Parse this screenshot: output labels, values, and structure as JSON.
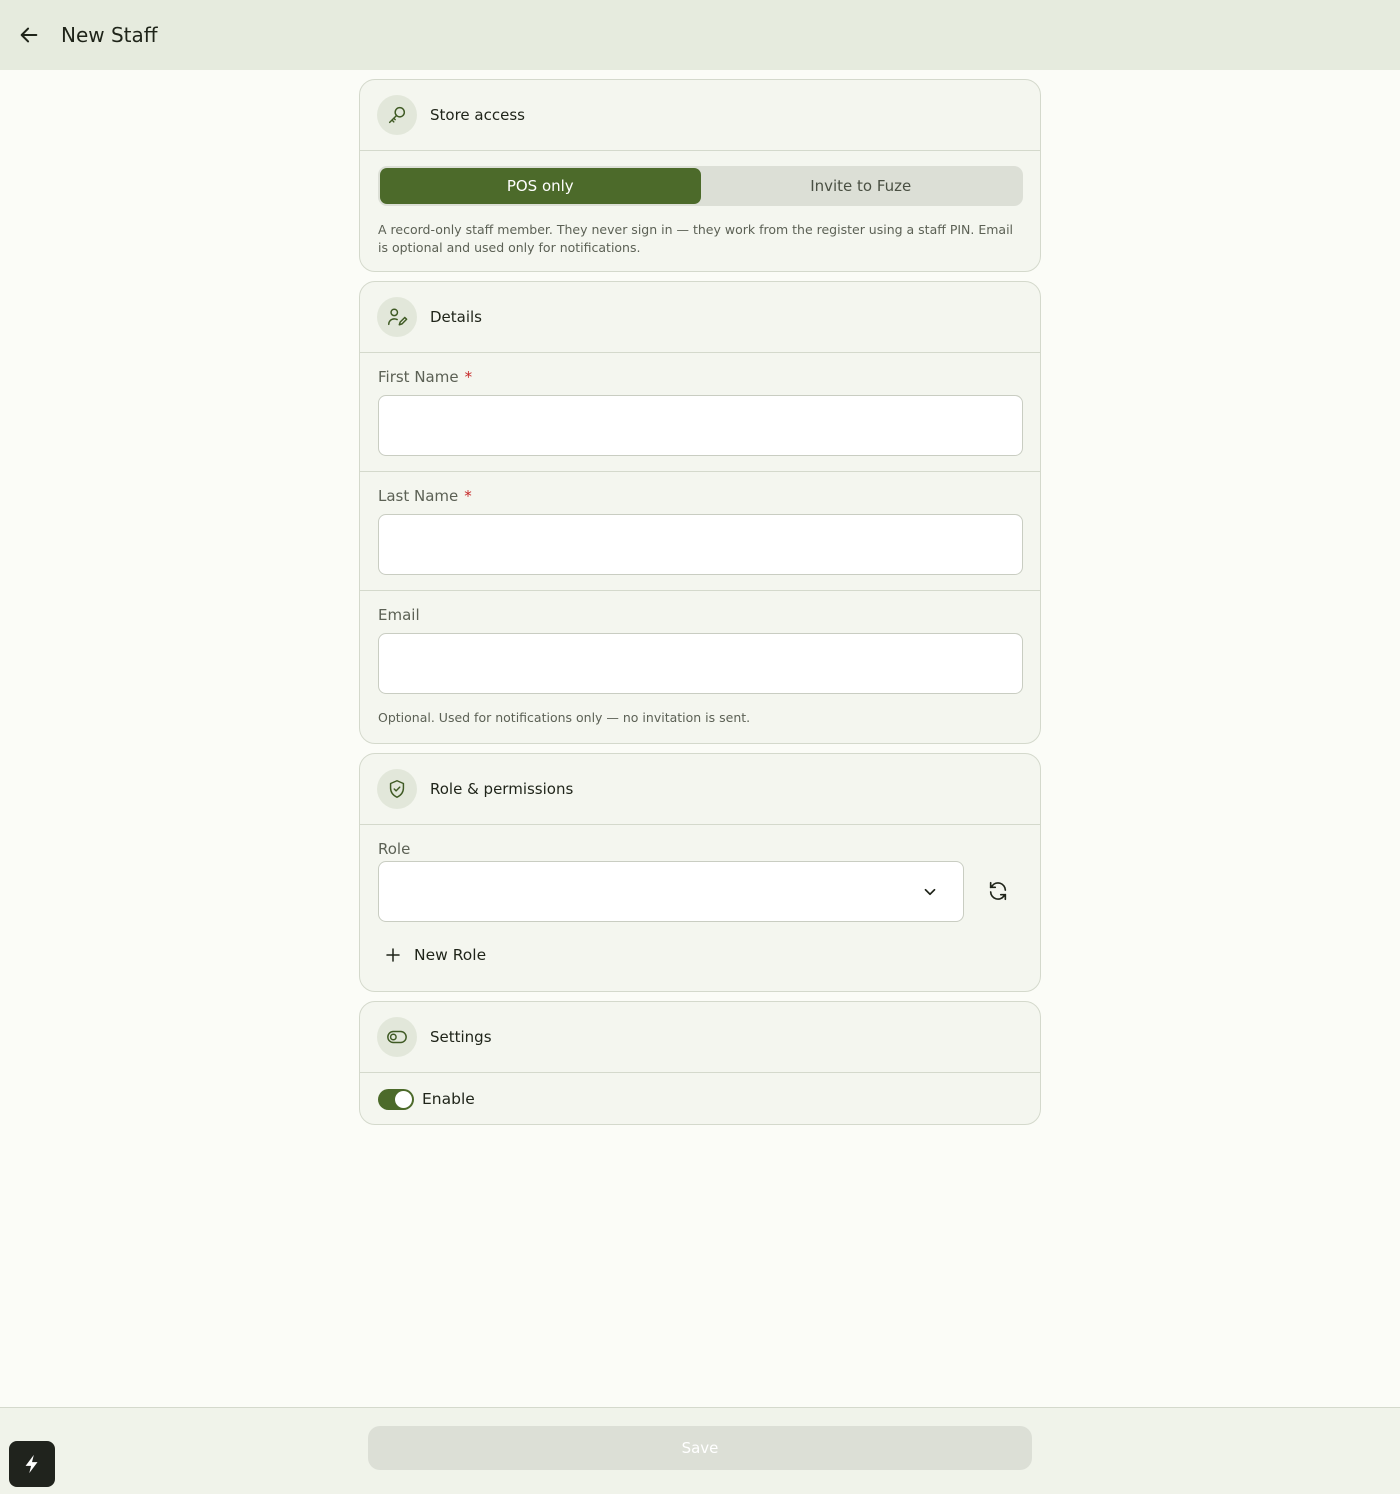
{
  "header": {
    "title": "New Staff",
    "back_icon": "arrow-left-icon"
  },
  "store_access": {
    "title": "Store access",
    "icon": "key-icon",
    "options": [
      "POS only",
      "Invite to Fuze"
    ],
    "selected": "POS only",
    "help": "A record-only staff member. They never sign in — they work from the register using a staff PIN. Email is optional and used only for notifications."
  },
  "details": {
    "title": "Details",
    "icon": "user-edit-icon",
    "first_name": {
      "label": "First Name",
      "required_mark": "*",
      "value": ""
    },
    "last_name": {
      "label": "Last Name",
      "required_mark": "*",
      "value": ""
    },
    "email": {
      "label": "Email",
      "value": "",
      "help": "Optional. Used for notifications only — no invitation is sent."
    }
  },
  "role": {
    "title": "Role & permissions",
    "icon": "shield-check-icon",
    "label": "Role",
    "value": "",
    "new_role_label": "New Role"
  },
  "settings": {
    "title": "Settings",
    "icon": "toggle-icon",
    "enable_label": "Enable",
    "enabled": true
  },
  "footer": {
    "save_label": "Save"
  },
  "colors": {
    "accent": "#4c6a2a",
    "header_bg": "#e6ebde",
    "required": "#c62828"
  }
}
